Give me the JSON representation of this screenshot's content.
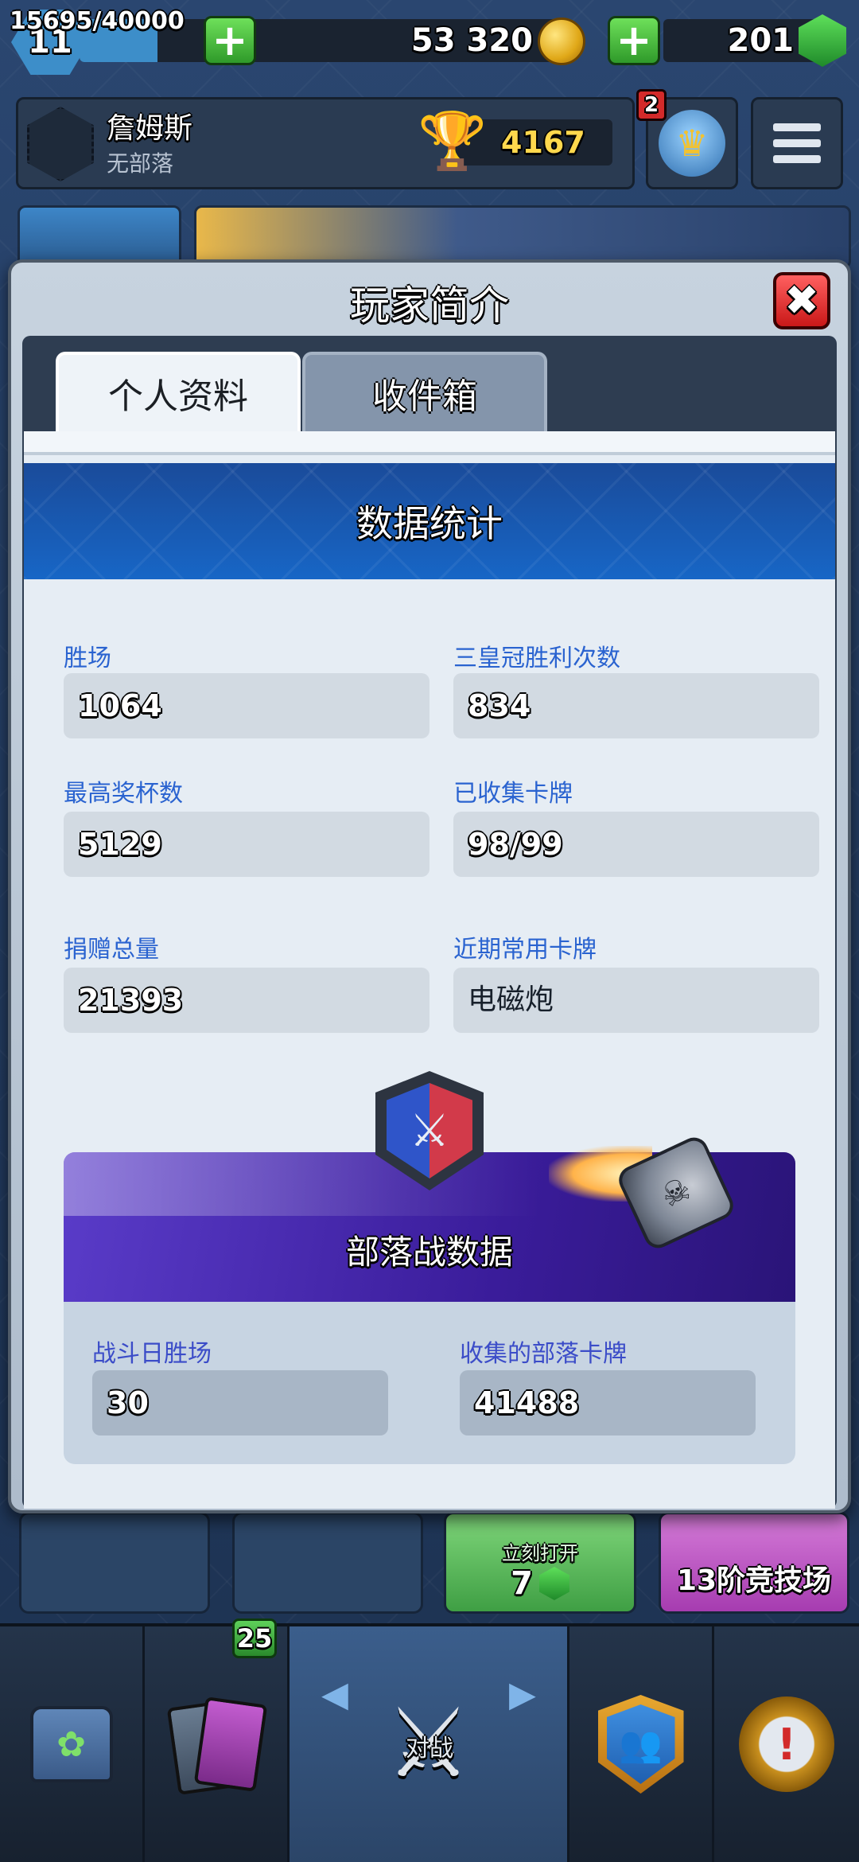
{
  "top_bar": {
    "level": "11",
    "xp_text": "15695/40000",
    "xp_progress": 0.392,
    "gold": "53 320",
    "gems": "201"
  },
  "profile": {
    "name": "詹姆斯",
    "clan": "无部落",
    "trophies": "4167",
    "notification_count": "2"
  },
  "modal": {
    "title": "玩家简介",
    "close_icon": "close-icon",
    "tabs": [
      {
        "label": "个人资料",
        "active": true
      },
      {
        "label": "收件箱",
        "active": false
      }
    ]
  },
  "stats": {
    "banner_title": "数据统计",
    "items": [
      {
        "label": "胜场",
        "value": "1064"
      },
      {
        "label": "三皇冠胜利次数",
        "value": "834"
      },
      {
        "label": "最高奖杯数",
        "value": "5129"
      },
      {
        "label": "已收集卡牌",
        "value": "98/99"
      },
      {
        "label": "捐赠总量",
        "value": "21393"
      },
      {
        "label": "近期常用卡牌",
        "value": "电磁炮"
      }
    ]
  },
  "clan_war": {
    "title": "部落战数据",
    "items": [
      {
        "label": "战斗日胜场",
        "value": "30"
      },
      {
        "label": "收集的部落卡牌",
        "value": "41488"
      }
    ]
  },
  "chest_slots": {
    "open_label": "立刻打开",
    "open_cost": "7",
    "arena_label": "13阶竞技场"
  },
  "bottom_nav": {
    "cards_badge": "25",
    "battle_label": "对战",
    "items": [
      "shop-chest-icon",
      "cards-icon",
      "battle-swords-icon",
      "clan-icon",
      "events-icon"
    ]
  },
  "colors": {
    "accent_blue": "#1766c6",
    "label_blue": "#2a63d0",
    "clan_war_purple": "#3a1c9a",
    "close_red": "#d32a2a",
    "gem_green": "#2f9a2a"
  }
}
